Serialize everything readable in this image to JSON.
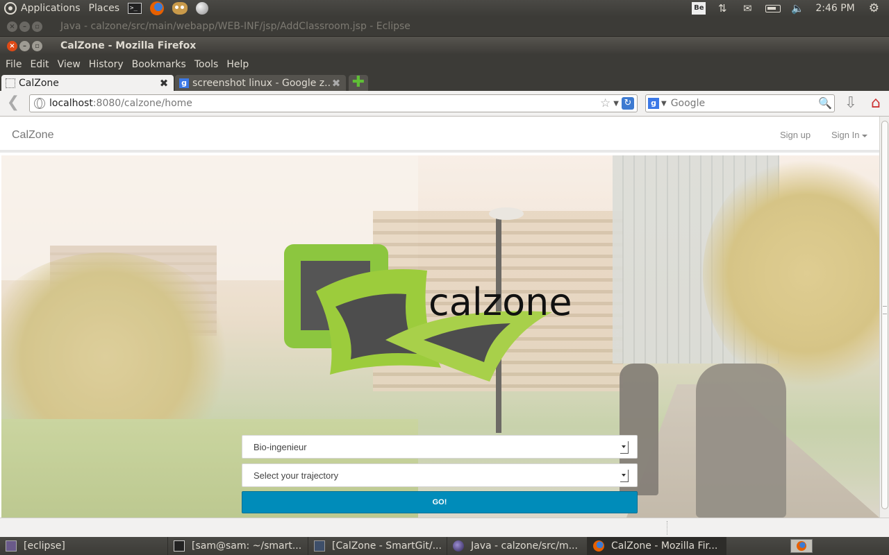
{
  "top_panel": {
    "applications": "Applications",
    "places": "Places",
    "indicator_be": "Be",
    "clock": "2:46 PM"
  },
  "eclipse_window": {
    "title": "Java - calzone/src/main/webapp/WEB-INF/jsp/AddClassroom.jsp - Eclipse"
  },
  "firefox": {
    "title": "CalZone - Mozilla Firefox",
    "menu": [
      "File",
      "Edit",
      "View",
      "History",
      "Bookmarks",
      "Tools",
      "Help"
    ],
    "tabs": [
      {
        "label": "CalZone",
        "active": true
      },
      {
        "label": "screenshot linux - Google z...",
        "active": false
      }
    ],
    "url_host": "localhost",
    "url_rest": ":8080/calzone/home",
    "search_placeholder": "Google"
  },
  "site": {
    "brand": "CalZone",
    "nav": {
      "sign_up": "Sign up",
      "sign_in": "Sign In"
    },
    "logo_text": "calzone",
    "colors": {
      "logo_green": "#8cc63f",
      "logo_dark": "#4d4d4d",
      "go_button": "#008cba"
    },
    "form": {
      "study_select_value": "Bio-ingenieur",
      "trajectory_select_value": "Select your trajectory",
      "go_label": "GO!"
    }
  },
  "taskbar": {
    "items": [
      "[eclipse]",
      "[sam@sam: ~/smart...",
      "[CalZone - SmartGit/...",
      "Java - calzone/src/m...",
      "CalZone - Mozilla Fir..."
    ]
  }
}
